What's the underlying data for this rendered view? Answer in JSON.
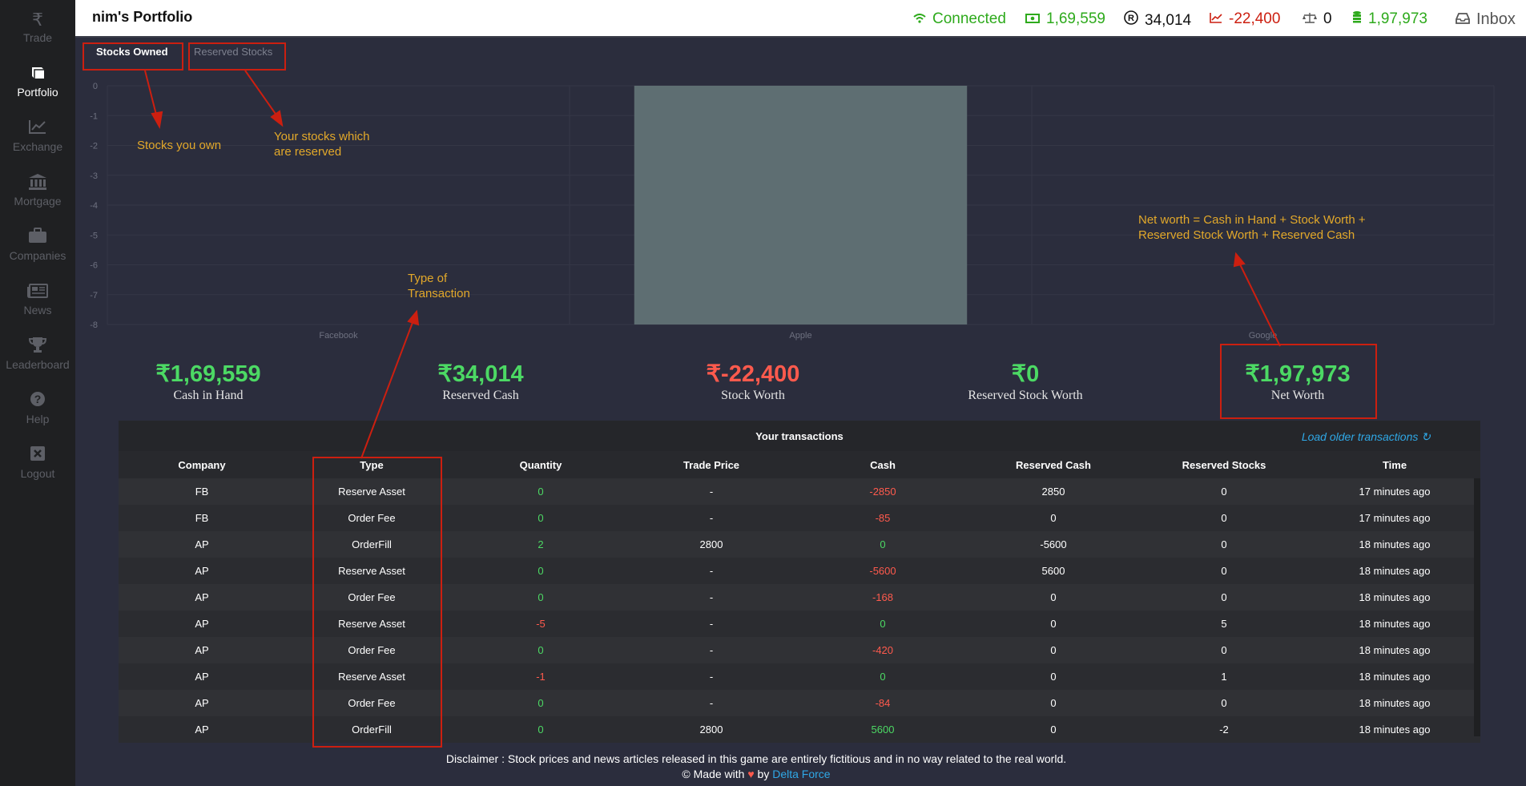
{
  "sidebar": {
    "items": [
      {
        "label": "Trade",
        "icon": "₹"
      },
      {
        "label": "Portfolio",
        "icon": "▬"
      },
      {
        "label": "Exchange",
        "icon": "📈"
      },
      {
        "label": "Mortgage",
        "icon": "🏛"
      },
      {
        "label": "Companies",
        "icon": "💼"
      },
      {
        "label": "News",
        "icon": "📰"
      },
      {
        "label": "Leaderboard",
        "icon": "🏆"
      },
      {
        "label": "Help",
        "icon": "?"
      },
      {
        "label": "Logout",
        "icon": "✖"
      }
    ]
  },
  "header": {
    "title": "nim's Portfolio",
    "connection": "Connected",
    "cash": "1,69,559",
    "reserved": "34,014",
    "stock_worth": "-22,400",
    "reserved_stock": "0",
    "net_worth": "1,97,973",
    "inbox": "Inbox"
  },
  "tabs": {
    "owned": "Stocks Owned",
    "reserved": "Reserved Stocks"
  },
  "chart_data": {
    "type": "bar",
    "categories": [
      "Facebook",
      "Apple",
      "Google"
    ],
    "values": [
      0,
      -8,
      0
    ],
    "ylim": [
      -8,
      0
    ],
    "yticks": [
      "0",
      "-1",
      "-2",
      "-3",
      "-4",
      "-5",
      "-6",
      "-7",
      "-8"
    ],
    "bar_color": "#5e6e72"
  },
  "summary": [
    {
      "amount": "1,69,559",
      "caption": "Cash in Hand",
      "color": "green"
    },
    {
      "amount": "34,014",
      "caption": "Reserved Cash",
      "color": "green"
    },
    {
      "amount": "-22,400",
      "caption": "Stock Worth",
      "color": "red"
    },
    {
      "amount": "0",
      "caption": "Reserved Stock Worth",
      "color": "green"
    },
    {
      "amount": "1,97,973",
      "caption": "Net Worth",
      "color": "green"
    }
  ],
  "currency_symbol": "₹",
  "transactions": {
    "title": "Your transactions",
    "load_older": "Load older transactions ↻",
    "columns": [
      "Company",
      "Type",
      "Quantity",
      "Trade Price",
      "Cash",
      "Reserved Cash",
      "Reserved Stocks",
      "Time"
    ],
    "rows": [
      [
        "FB",
        "Reserve Asset",
        "0",
        "-",
        "-2850",
        "2850",
        "0",
        "17 minutes ago"
      ],
      [
        "FB",
        "Order Fee",
        "0",
        "-",
        "-85",
        "0",
        "0",
        "17 minutes ago"
      ],
      [
        "AP",
        "OrderFill",
        "2",
        "2800",
        "0",
        "-5600",
        "0",
        "18 minutes ago"
      ],
      [
        "AP",
        "Reserve Asset",
        "0",
        "-",
        "-5600",
        "5600",
        "0",
        "18 minutes ago"
      ],
      [
        "AP",
        "Order Fee",
        "0",
        "-",
        "-168",
        "0",
        "0",
        "18 minutes ago"
      ],
      [
        "AP",
        "Reserve Asset",
        "-5",
        "-",
        "0",
        "0",
        "5",
        "18 minutes ago"
      ],
      [
        "AP",
        "Order Fee",
        "0",
        "-",
        "-420",
        "0",
        "0",
        "18 minutes ago"
      ],
      [
        "AP",
        "Reserve Asset",
        "-1",
        "-",
        "0",
        "0",
        "1",
        "18 minutes ago"
      ],
      [
        "AP",
        "Order Fee",
        "0",
        "-",
        "-84",
        "0",
        "0",
        "18 minutes ago"
      ],
      [
        "AP",
        "OrderFill",
        "0",
        "2800",
        "5600",
        "0",
        "-2",
        "18 minutes ago"
      ]
    ]
  },
  "footer": {
    "disclaimer": "Disclaimer : Stock prices and news articles released in this game are entirely fictitious and in no way related to the real world.",
    "made_with": "© Made with",
    "heart": "♥",
    "by": "by",
    "team": "Delta Force"
  },
  "annotations": {
    "stocks_owned": "Stocks you own",
    "reserved_line1": "Your stocks which",
    "reserved_line2": "are reserved",
    "type_line1": "Type of",
    "type_line2": "Transaction",
    "net_line1": "Net worth = Cash in Hand + Stock Worth +",
    "net_line2": "Reserved Stock Worth + Reserved Cash"
  },
  "colors": {
    "positive": "#4cd964",
    "negative": "#ff5a4d",
    "header_green": "#2eaa1c",
    "header_red": "#cc1f10",
    "annotation": "#e2a82a",
    "annotation_box": "#cc1f10"
  }
}
